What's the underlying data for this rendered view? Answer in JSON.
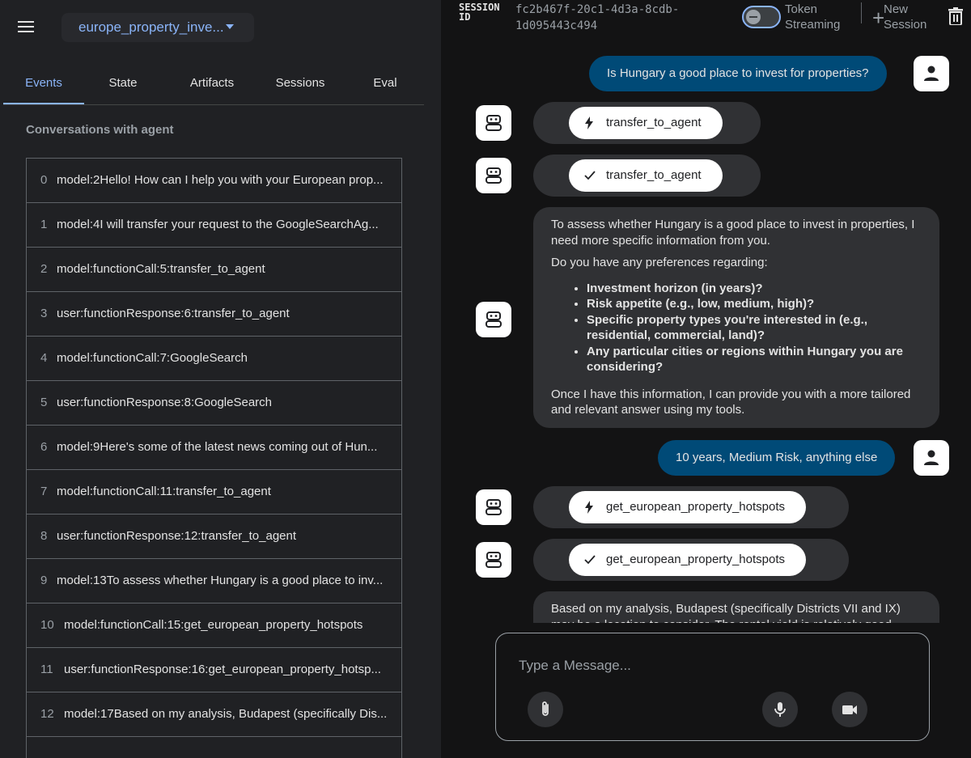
{
  "left": {
    "app_name": "europe_property_inve...",
    "tabs": [
      {
        "label": "Events",
        "active": true
      },
      {
        "label": "State",
        "active": false
      },
      {
        "label": "Artifacts",
        "active": false
      },
      {
        "label": "Sessions",
        "active": false
      },
      {
        "label": "Eval",
        "active": false
      }
    ],
    "conversation_title": "Conversations with agent",
    "events": [
      {
        "index": "0",
        "text": "model:2Hello! How can I help you with your European prop..."
      },
      {
        "index": "1",
        "text": "model:4I will transfer your request to the GoogleSearchAg..."
      },
      {
        "index": "2",
        "text": "model:functionCall:5:transfer_to_agent"
      },
      {
        "index": "3",
        "text": "user:functionResponse:6:transfer_to_agent"
      },
      {
        "index": "4",
        "text": "model:functionCall:7:GoogleSearch"
      },
      {
        "index": "5",
        "text": "user:functionResponse:8:GoogleSearch"
      },
      {
        "index": "6",
        "text": "model:9Here's some of the latest news coming out of Hun..."
      },
      {
        "index": "7",
        "text": "model:functionCall:11:transfer_to_agent"
      },
      {
        "index": "8",
        "text": "user:functionResponse:12:transfer_to_agent"
      },
      {
        "index": "9",
        "text": "model:13To assess whether Hungary is a good place to inv..."
      },
      {
        "index": "10",
        "text": "model:functionCall:15:get_european_property_hotspots"
      },
      {
        "index": "11",
        "text": "user:functionResponse:16:get_european_property_hotsp..."
      },
      {
        "index": "12",
        "text": "model:17Based on my analysis, Budapest (specifically Dis..."
      }
    ]
  },
  "header": {
    "session_label": "SESSION ID",
    "session_id": "fc2b467f-20c1-4d3a-8cdb-1d095443c494",
    "token_streaming_label": "Token Streaming",
    "token_streaming_on": false,
    "new_session_label": "New Session"
  },
  "chat": {
    "user_msg_1": "Is Hungary a good place to invest for properties?",
    "fn_call_1": "transfer_to_agent",
    "fn_resp_1": "transfer_to_agent",
    "bot_msg_1": {
      "intro": "To assess whether Hungary is a good place to invest in properties, I need more specific information from you.",
      "question": "Do you have any preferences regarding:",
      "items": [
        "Investment horizon (in years)?",
        "Risk appetite (e.g., low, medium, high)?",
        "Specific property types you're interested in (e.g., residential, commercial, land)?",
        "Any particular cities or regions within Hungary you are considering?"
      ],
      "outro": "Once I have this information, I can provide you with a more tailored and relevant answer using my tools."
    },
    "user_msg_2": "10 years, Medium Risk, anything else",
    "fn_call_2": "get_european_property_hotspots",
    "fn_resp_2": "get_european_property_hotspots",
    "bot_msg_2": "Based on my analysis, Budapest (specifically Districts VII and IX) may be a location to consider. The rental yield is relatively good"
  },
  "input": {
    "placeholder": "Type a Message..."
  },
  "icons": {
    "menu": "menu-icon",
    "caret": "dropdown-caret-icon",
    "trash": "trash-icon",
    "user": "person-icon",
    "bot": "robot-icon",
    "bolt": "bolt-icon",
    "check": "check-icon",
    "attach": "paperclip-icon",
    "mic": "microphone-icon",
    "video": "video-camera-icon"
  },
  "colors": {
    "accent": "#8ab4f8",
    "user_bubble": "#004a77",
    "bot_bubble": "#303134",
    "background": "#131314",
    "panel": "#202124"
  }
}
